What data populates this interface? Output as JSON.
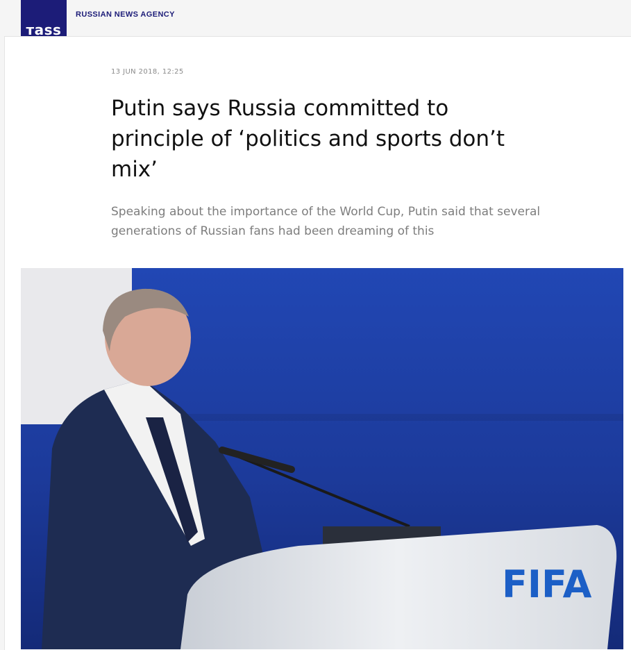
{
  "header": {
    "logo_text": "тass",
    "agency_name": "RUSSIAN NEWS AGENCY"
  },
  "article": {
    "date": "13 JUN 2018, 12:25",
    "headline": "Putin says Russia committed to principle of ‘politics and sports don’t mix’",
    "lead": "Speaking about the importance of the World Cup, Putin said that several generations of Russian fans had been dreaming of this"
  },
  "photo": {
    "podium_logo_text": "FIFA"
  },
  "colors": {
    "brand": "#1c1c78",
    "backdrop_blue": "#1e3a9e",
    "podium": "#e6e9ee",
    "fifa_blue": "#1c5fc6"
  }
}
